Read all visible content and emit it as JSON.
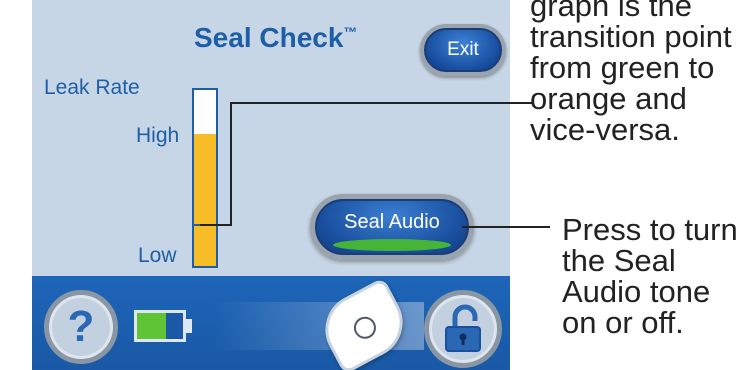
{
  "screen": {
    "title": "Seal Check",
    "trademark": "™",
    "exit_label": "Exit"
  },
  "leak_rate": {
    "label": "Leak Rate",
    "high_label": "High",
    "low_label": "Low",
    "fill_level": 0.75,
    "threshold_level": 0.24
  },
  "seal_audio": {
    "label": "Seal Audio"
  },
  "bottom_bar": {
    "help_symbol": "?",
    "battery_level": 0.62,
    "help_icon": "help-icon",
    "lock_icon": "unlocked-padlock-icon"
  },
  "callouts": {
    "threshold_text": "graph is the transition point from green to orange and vice-versa.",
    "seal_audio_text": "Press to turn the Seal Audio tone on or off."
  },
  "colors": {
    "screen_bg": "#c7d6e6",
    "accent_blue": "#1e5ea7",
    "bar_fill": "#f7bd27",
    "battery_fill": "#60c437",
    "seal_glow": "#46b437"
  }
}
